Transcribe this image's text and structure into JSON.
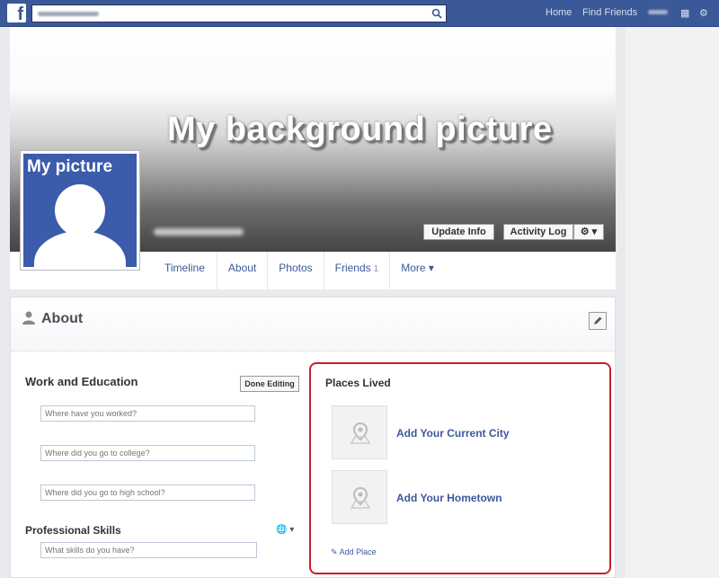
{
  "topbar": {
    "logo": "f",
    "search_placeholder": "",
    "nav": {
      "home": "Home",
      "find_friends": "Find Friends"
    }
  },
  "cover": {
    "title": "My background picture",
    "avatar_label": "My picture",
    "update_info": "Update Info",
    "activity_log": "Activity Log",
    "gear": "⚙ ▾"
  },
  "tabs": [
    {
      "label": "Timeline"
    },
    {
      "label": "About"
    },
    {
      "label": "Photos"
    },
    {
      "label": "Friends",
      "count": "1"
    },
    {
      "label": "More ▾"
    }
  ],
  "about": {
    "title": "About",
    "work_education": {
      "title": "Work and Education",
      "done_button": "Done Editing",
      "fields": [
        "Where have you worked?",
        "Where did you go to college?",
        "Where did you go to high school?"
      ]
    },
    "skills": {
      "title": "Professional Skills",
      "placeholder": "What skills do you have?"
    },
    "places": {
      "title": "Places Lived",
      "current_city": "Add Your Current City",
      "hometown": "Add Your Hometown",
      "add_place": "Add Place"
    }
  },
  "colors": {
    "brand": "#3b5998",
    "highlight": "#c9202a",
    "avatar": "#3b5bab"
  }
}
